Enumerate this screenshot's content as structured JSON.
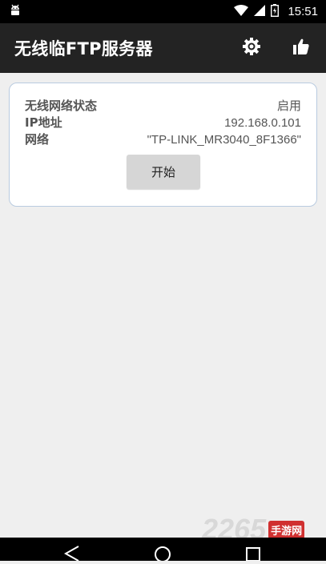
{
  "status_bar": {
    "time": "15:51",
    "icons": [
      "android-icon",
      "wifi-icon",
      "signal-icon",
      "battery-icon"
    ]
  },
  "app_bar": {
    "title": "无线临FTP服务器",
    "actions": [
      "gear-icon",
      "thumbs-up-icon"
    ]
  },
  "status_card": {
    "rows": [
      {
        "label": "无线网络状态",
        "value": "启用"
      },
      {
        "label": "IP地址",
        "value": "192.168.0.101"
      },
      {
        "label": "网络",
        "value": "\"TP-LINK_MR3040_8F1366\""
      }
    ],
    "start_button": "开始"
  },
  "watermark": {
    "number": "2265",
    "text": "手游网"
  },
  "colors": {
    "app_bar": "#232323",
    "card_border": "#b9cbe0",
    "button": "#d6d6d6",
    "background": "#efefef"
  }
}
